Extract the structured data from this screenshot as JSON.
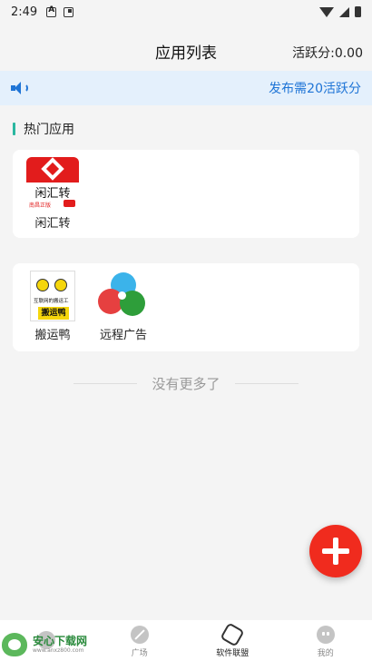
{
  "status_bar": {
    "time": "2:49"
  },
  "header": {
    "title": "应用列表",
    "active_score": "活跃分:0.00"
  },
  "notice": {
    "text": "发布需20活跃分",
    "icon": "speaker-icon"
  },
  "hot_section": {
    "title": "热门应用",
    "apps": [
      {
        "label": "闲汇转",
        "icon_text": "闲汇转",
        "icon_sub": "南昌正版"
      }
    ]
  },
  "apps": [
    {
      "label": "搬运鸭",
      "icon_caption": "互联网的搬运工",
      "icon_tag": "搬运鸭"
    },
    {
      "label": "远程广告"
    }
  ],
  "footer_text": "没有更多了",
  "bottom_nav": {
    "items": [
      {
        "label": "",
        "icon": "home-icon"
      },
      {
        "label": "广场",
        "icon": "plaza-icon"
      },
      {
        "label": "软件联盟",
        "icon": "cube-icon"
      },
      {
        "label": "我的",
        "icon": "mine-icon"
      }
    ]
  },
  "watermark": {
    "name": "安心下载网",
    "url": "www.anxz800.com"
  },
  "colors": {
    "accent_blue": "#1e74d6",
    "fab_red": "#f02b1e",
    "section_accent": "#2ab7a0",
    "notice_bg": "#e4f0fc"
  }
}
